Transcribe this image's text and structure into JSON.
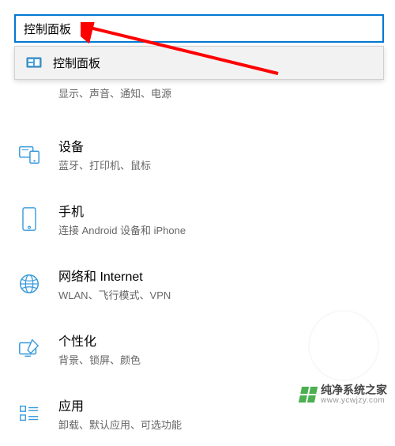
{
  "search": {
    "value": "控制面板"
  },
  "dropdown": {
    "items": [
      {
        "label": "控制面板",
        "icon": "control-panel"
      }
    ]
  },
  "partial_item": {
    "desc": "显示、声音、通知、电源"
  },
  "items": [
    {
      "key": "devices",
      "title": "设备",
      "desc": "蓝牙、打印机、鼠标"
    },
    {
      "key": "phone",
      "title": "手机",
      "desc": "连接 Android 设备和 iPhone"
    },
    {
      "key": "network",
      "title": "网络和 Internet",
      "desc": "WLAN、飞行模式、VPN"
    },
    {
      "key": "personalize",
      "title": "个性化",
      "desc": "背景、锁屏、颜色"
    },
    {
      "key": "apps",
      "title": "应用",
      "desc": "卸载、默认应用、可选功能"
    }
  ],
  "watermark": {
    "name": "纯净系统之家",
    "url": "www.ycwjzy.com"
  }
}
